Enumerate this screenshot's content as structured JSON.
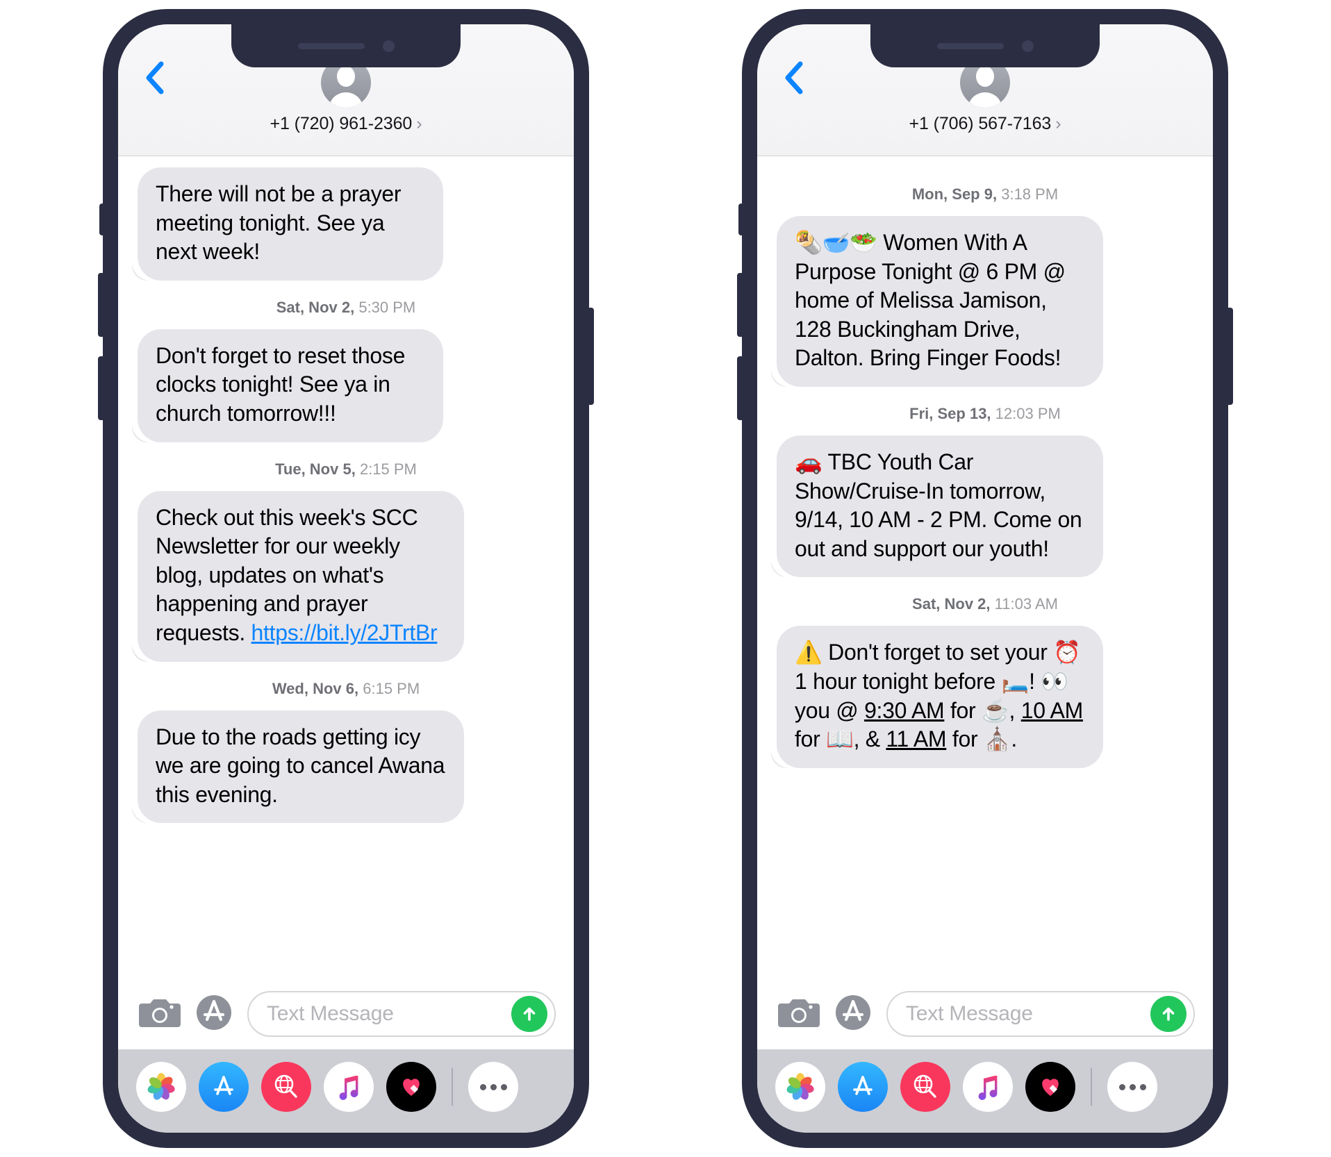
{
  "phones": [
    {
      "id": "phone-left",
      "header": {
        "back_label": "Back",
        "contact_number": "+1 (720) 961-2360",
        "chevron": "›"
      },
      "thread": [
        {
          "type": "message",
          "text": "There will not be a prayer meeting tonight. See ya next week!"
        },
        {
          "type": "timestamp",
          "date": "Sat, Nov 2,",
          "time": "5:30 PM"
        },
        {
          "type": "message",
          "text": "Don't forget to reset those clocks tonight! See ya in church tomorrow!!!"
        },
        {
          "type": "timestamp",
          "date": "Tue, Nov 5,",
          "time": "2:15 PM"
        },
        {
          "type": "message-link",
          "text": "Check out this week's SCC Newsletter for our weekly blog, updates on what's happening and prayer requests. ",
          "link": "https://bit.ly/2JTrtBr"
        },
        {
          "type": "timestamp",
          "date": "Wed, Nov 6,",
          "time": "6:15 PM"
        },
        {
          "type": "message",
          "text": "Due to the roads getting icy we are going to cancel Awana this evening."
        }
      ],
      "compose": {
        "camera_label": "Camera",
        "apps_label": "App Store",
        "placeholder": "Text Message",
        "send_label": "Send"
      },
      "tray": {
        "apps": [
          {
            "name": "photos-app",
            "label": "Photos"
          },
          {
            "name": "app-store-app",
            "label": "App Store"
          },
          {
            "name": "images-app",
            "label": "#images"
          },
          {
            "name": "music-app",
            "label": "Music"
          },
          {
            "name": "digital-touch-app",
            "label": "Digital Touch"
          },
          {
            "name": "more-app",
            "label": "More"
          }
        ]
      }
    },
    {
      "id": "phone-right",
      "header": {
        "back_label": "Back",
        "contact_number": "+1 (706) 567-7163",
        "chevron": "›"
      },
      "thread": [
        {
          "type": "timestamp",
          "date": "Mon, Sep 9,",
          "time": "3:18 PM"
        },
        {
          "type": "message",
          "text": "🌯🥣🥗 Women With A Purpose Tonight @ 6 PM @ home of Melissa Jamison, 128 Buckingham Drive, Dalton. Bring Finger Foods!"
        },
        {
          "type": "timestamp",
          "date": "Fri, Sep 13,",
          "time": "12:03 PM"
        },
        {
          "type": "message",
          "text": "🚗 TBC Youth Car Show/Cruise-In tomorrow, 9/14, 10 AM - 2 PM. Come on out and support our youth!"
        },
        {
          "type": "timestamp",
          "date": "Sat, Nov 2,",
          "time": "11:03 AM"
        },
        {
          "type": "message-times",
          "prefix": "⚠️ Don't forget to set your ⏰ 1 hour tonight before 🛏️! 👀 you @ ",
          "t1": "9:30 AM",
          "mid1": " for ☕, ",
          "t2": "10 AM",
          "mid2": " for 📖, & ",
          "t3": "11 AM",
          "suffix": " for ⛪."
        }
      ],
      "compose": {
        "camera_label": "Camera",
        "apps_label": "App Store",
        "placeholder": "Text Message",
        "send_label": "Send"
      },
      "tray": {
        "apps": [
          {
            "name": "photos-app",
            "label": "Photos"
          },
          {
            "name": "app-store-app",
            "label": "App Store"
          },
          {
            "name": "images-app",
            "label": "#images"
          },
          {
            "name": "music-app",
            "label": "Music"
          },
          {
            "name": "digital-touch-app",
            "label": "Digital Touch"
          },
          {
            "name": "more-app",
            "label": "More"
          }
        ]
      }
    }
  ],
  "colors": {
    "bezel": "#2b2d42",
    "bubble": "#e6e5ea",
    "link": "#0b84ff",
    "send": "#22c75b",
    "back_chevron": "#0b84ff",
    "timestamp": "#9b9ba0",
    "tray_bg": "#cdced4"
  }
}
